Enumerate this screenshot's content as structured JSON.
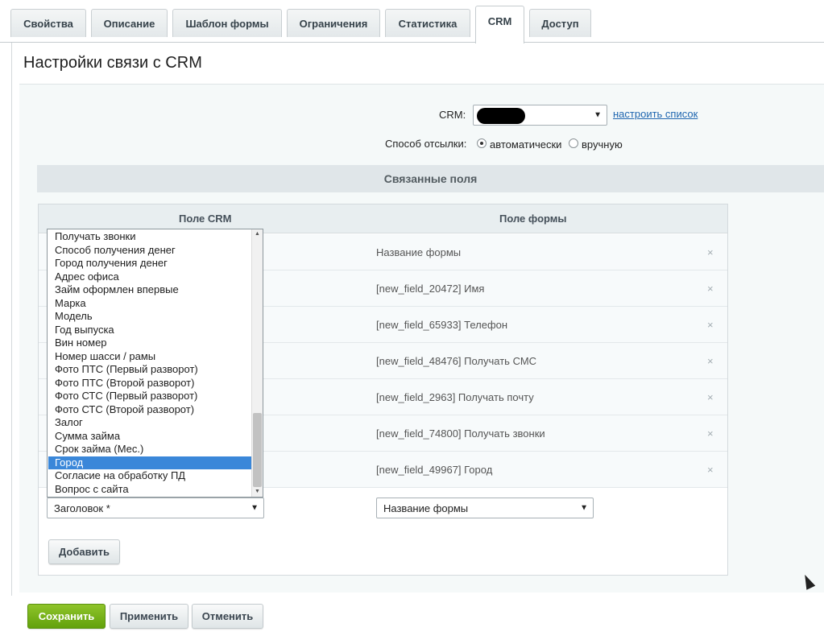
{
  "tabs": [
    {
      "label": "Свойства",
      "active": false
    },
    {
      "label": "Описание",
      "active": false
    },
    {
      "label": "Шаблон формы",
      "active": false
    },
    {
      "label": "Ограничения",
      "active": false
    },
    {
      "label": "Статистика",
      "active": false
    },
    {
      "label": "CRM",
      "active": true
    },
    {
      "label": "Доступ",
      "active": false
    }
  ],
  "page_title": "Настройки связи с CRM",
  "crm": {
    "label": "CRM:",
    "configure_link": "настроить список"
  },
  "send_mode": {
    "label": "Способ отсылки:",
    "options": [
      {
        "label": "автоматически",
        "checked": true
      },
      {
        "label": "вручную",
        "checked": false
      }
    ]
  },
  "linked_fields": {
    "title": "Связанные поля",
    "col_crm": "Поле CRM",
    "col_form": "Поле формы",
    "rows": [
      {
        "form_field": "Название формы"
      },
      {
        "form_field": "[new_field_20472] Имя"
      },
      {
        "form_field": "[new_field_65933] Телефон"
      },
      {
        "form_field": "[new_field_48476] Получать СМС"
      },
      {
        "form_field": "[new_field_2963] Получать почту"
      },
      {
        "form_field": "[new_field_74800] Получать звонки"
      },
      {
        "form_field": "[new_field_49967] Город"
      }
    ],
    "remove_glyph": "×",
    "dropdown_options": [
      "Получать звонки",
      "Способ получения денег",
      "Город получения денег",
      "Адрес офиса",
      "Займ оформлен впервые",
      "Марка",
      "Модель",
      "Год выпуска",
      "Вин номер",
      "Номер шасси / рамы",
      "Фото ПТС (Первый разворот)",
      "Фото ПТС (Второй разворот)",
      "Фото СТС (Первый разворот)",
      "Фото СТС (Второй разворот)",
      "Залог",
      "Сумма займа",
      "Срок займа (Мес.)",
      "Город",
      "Согласие на обработку ПД",
      "Вопрос с сайта"
    ],
    "selected_option_index": 17,
    "new_crm_field_value": "Заголовок *",
    "new_form_field_value": "Название формы",
    "add_button": "Добавить"
  },
  "footer": {
    "save": "Сохранить",
    "apply": "Применить",
    "cancel": "Отменить"
  },
  "colors": {
    "accent_green": "#6aab11",
    "link_blue": "#2067b0",
    "selection_blue": "#3a87d9"
  },
  "icons": {
    "dropdown_arrow": "▼",
    "scroll_up": "▲",
    "scroll_down": "▼"
  }
}
